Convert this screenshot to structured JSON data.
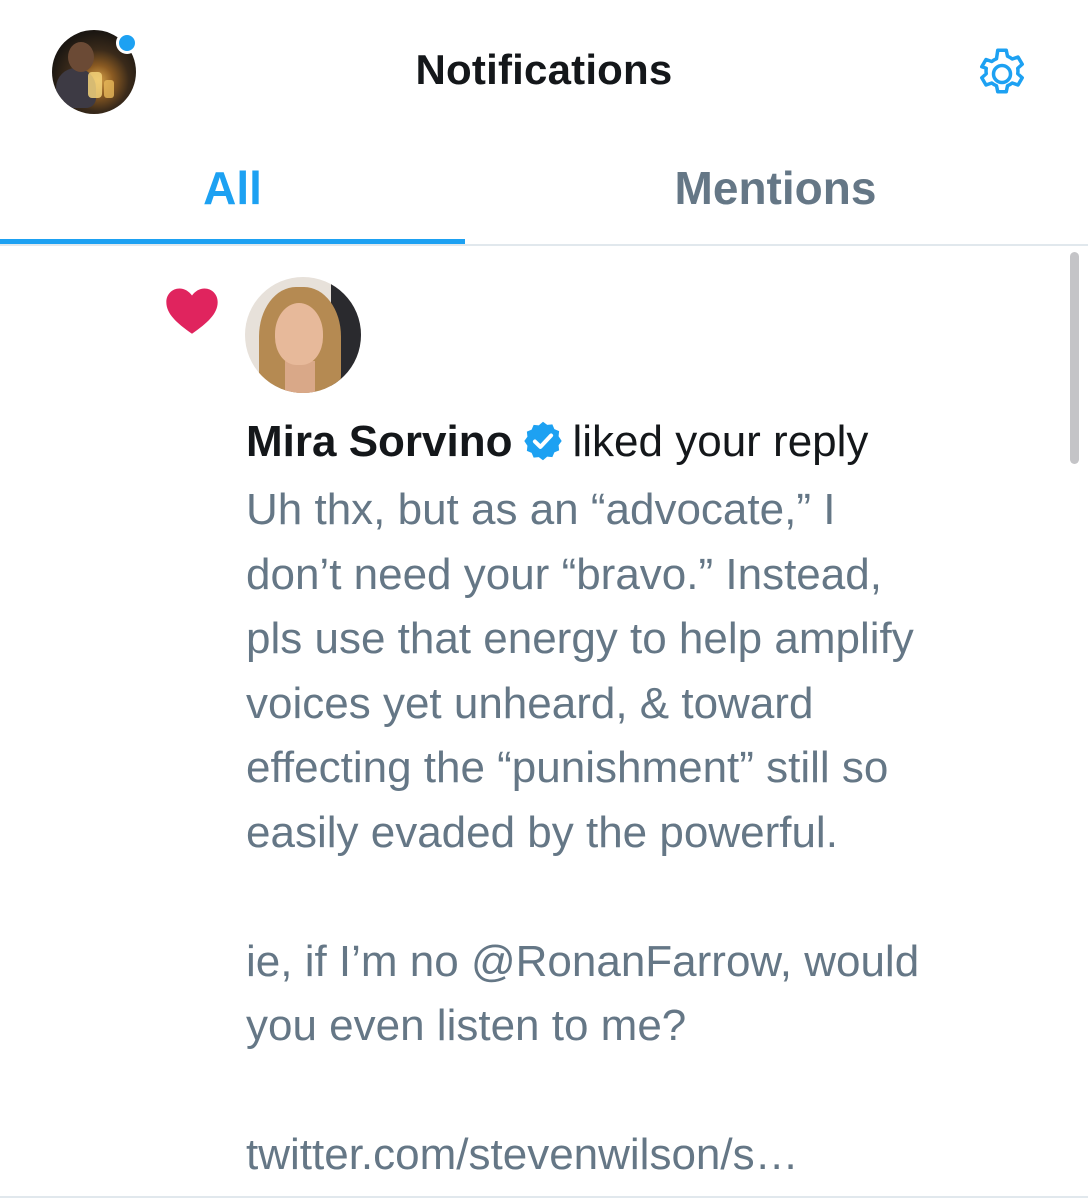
{
  "header": {
    "title": "Notifications",
    "avatar_icon": "profile-avatar",
    "settings_icon": "gear-icon",
    "accent_color": "#1da1f2"
  },
  "tabs": [
    {
      "label": "All",
      "active": true
    },
    {
      "label": "Mentions",
      "active": false
    }
  ],
  "notification": {
    "type_icon": "heart-icon",
    "type_color": "#e0245e",
    "user_name": "Mira Sorvino",
    "verified": true,
    "action": "liked your reply",
    "tweet_lines": [
      "Uh thx, but as an “advocate,” I",
      "don’t need your “bravo.” Instead,",
      "pls use that energy to help amplify",
      "voices yet unheard, & toward",
      "effecting the “punishment” still so",
      "easily evaded by the powerful.",
      "",
      "ie, if I’m no @RonanFarrow, would",
      "you even listen to me?",
      "",
      "twitter.com/stevenwilson/s…"
    ]
  }
}
